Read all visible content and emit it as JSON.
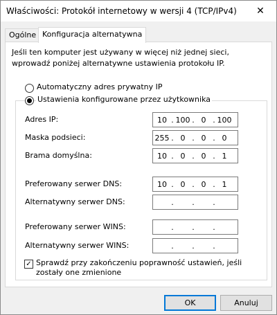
{
  "window": {
    "title": "Właściwości: Protokół internetowy w wersji 4 (TCP/IPv4)",
    "close_glyph": "✕"
  },
  "tabs": [
    {
      "label": "Ogólne",
      "active": false
    },
    {
      "label": "Konfiguracja alternatywna",
      "active": true
    }
  ],
  "description": "Jeśli ten komputer jest używany w więcej niż jednej sieci, wprowadź poniżej alternatywne ustawienia protokołu IP.",
  "radios": {
    "auto": {
      "label": "Automatyczny adres prywatny IP",
      "checked": false
    },
    "user": {
      "label": "Ustawienia konfigurowane przez użytkownika",
      "checked": true
    }
  },
  "fields": [
    {
      "label": "Adres IP:",
      "value": [
        "10",
        "100",
        "0",
        "100"
      ]
    },
    {
      "label": "Maska podsieci:",
      "value": [
        "255",
        "0",
        "0",
        "0"
      ]
    },
    {
      "label": "Brama domyślna:",
      "value": [
        "10",
        "0",
        "0",
        "1"
      ]
    },
    {
      "label": "Preferowany serwer DNS:",
      "value": [
        "10",
        "0",
        "0",
        "1"
      ]
    },
    {
      "label": "Alternatywny serwer DNS:",
      "value": [
        "",
        "",
        "",
        ""
      ]
    },
    {
      "label": "Preferowany serwer WINS:",
      "value": [
        "",
        "",
        "",
        ""
      ]
    },
    {
      "label": "Alternatywny serwer WINS:",
      "value": [
        "",
        "",
        "",
        ""
      ]
    }
  ],
  "validate": {
    "label": "Sprawdź przy zakończeniu poprawność ustawień, jeśli zostały one zmienione",
    "checked": true
  },
  "buttons": {
    "ok": "OK",
    "cancel": "Anuluj"
  },
  "dot": "."
}
